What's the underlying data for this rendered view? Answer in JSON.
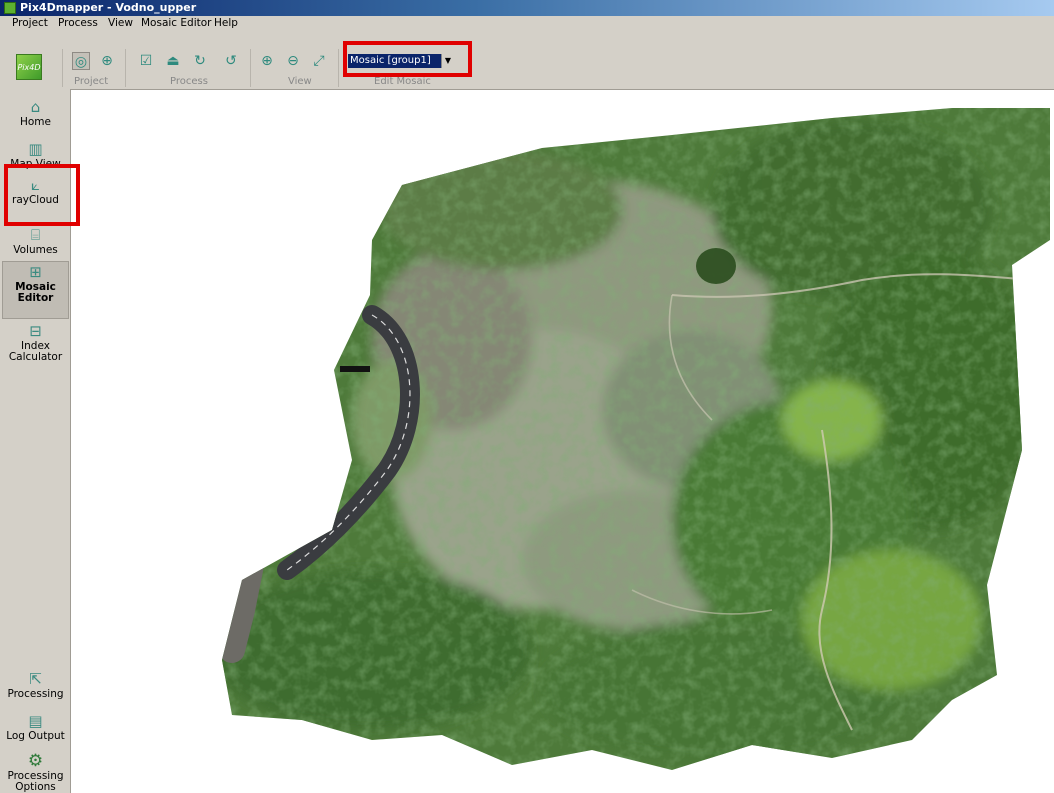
{
  "window": {
    "title": "Pix4Dmapper - Vodno_upper"
  },
  "menu": [
    "Project",
    "Process",
    "View",
    "Mosaic Editor",
    "Help"
  ],
  "toolbar": {
    "logo_label": "Pix4D",
    "groups": {
      "project": "Project",
      "process": "Process",
      "view": "View",
      "edit_mosaic": "Edit Mosaic"
    },
    "icons": {
      "project": [
        "layers-icon",
        "crosshair-icon"
      ],
      "process": [
        "check-document-icon",
        "output-tray-icon",
        "refresh-icon",
        "refresh-alt-icon"
      ],
      "view": [
        "zoom-in-icon",
        "zoom-out-icon",
        "fit-extent-icon"
      ]
    },
    "mosaic_select": {
      "value": "Mosaic [group1]"
    }
  },
  "sidebar": {
    "items": [
      {
        "label": "Home",
        "icon": "home-icon",
        "active": false
      },
      {
        "label": "Map View",
        "icon": "map-icon",
        "active": false
      },
      {
        "label": "rayCloud",
        "icon": "raycloud-icon",
        "active": false
      },
      {
        "label": "Volumes",
        "icon": "cylinder-icon",
        "active": false
      },
      {
        "label": "Mosaic Editor",
        "icon": "mosaic-icon",
        "active": true
      },
      {
        "label": "Index Calculator",
        "icon": "calculator-icon",
        "active": false
      }
    ],
    "bottom_items": [
      {
        "label": "Processing",
        "icon": "processing-icon"
      },
      {
        "label": "Log Output",
        "icon": "log-icon"
      },
      {
        "label": "Processing Options",
        "icon": "gear-icon"
      }
    ]
  },
  "colors": {
    "highlight": "#e00000",
    "accent_icon": "#3a8a80",
    "vegetation_dark": "#2f5a25",
    "vegetation_light": "#6f9a4a",
    "bare_ground": "#a8a898",
    "road": "#3a3c40"
  },
  "map": {
    "content": "orthomosaic"
  }
}
